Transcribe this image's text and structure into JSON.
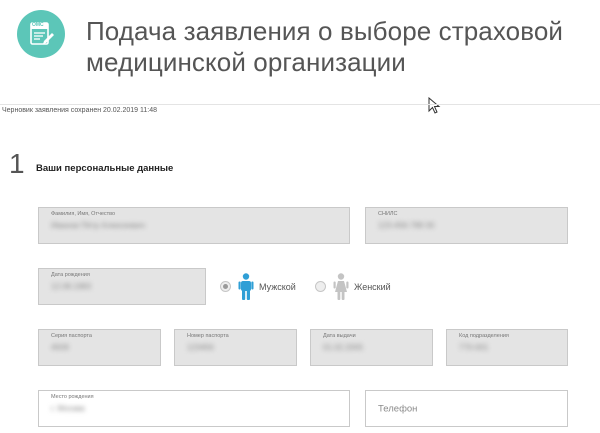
{
  "header": {
    "logo_text": "ОМС",
    "title_line1": "Подача заявления о выборе страховой",
    "title_line2": "медицинской организации"
  },
  "draft_status": "Черновик заявления сохранен 20.02.2019 11:48",
  "section": {
    "number": "1",
    "title": "Ваши персональные данные"
  },
  "fields": {
    "full_name": {
      "label": "Фамилия, Имя, Отчество",
      "value": "Иванов Пётр Алексеевич"
    },
    "snils": {
      "label": "СНИЛС",
      "value": "123-456-789 00"
    },
    "birth_date": {
      "label": "Дата рождения",
      "value": "12.08.1983"
    },
    "passport_series": {
      "label": "Серия паспорта",
      "value": "4509"
    },
    "passport_number": {
      "label": "Номер паспорта",
      "value": "123456"
    },
    "issue_date": {
      "label": "Дата выдачи",
      "value": "01.02.2005"
    },
    "division_code": {
      "label": "Код подразделения",
      "value": "770-001"
    },
    "birth_place": {
      "label": "Место рождения",
      "value": "г. Москва"
    },
    "phone": {
      "placeholder": "Телефон"
    }
  },
  "gender": {
    "male_label": "Мужской",
    "female_label": "Женский",
    "selected": "male",
    "male_color": "#2f9fd6",
    "female_color": "#c4c4c4"
  },
  "colors": {
    "accent": "#5cc6b8"
  }
}
